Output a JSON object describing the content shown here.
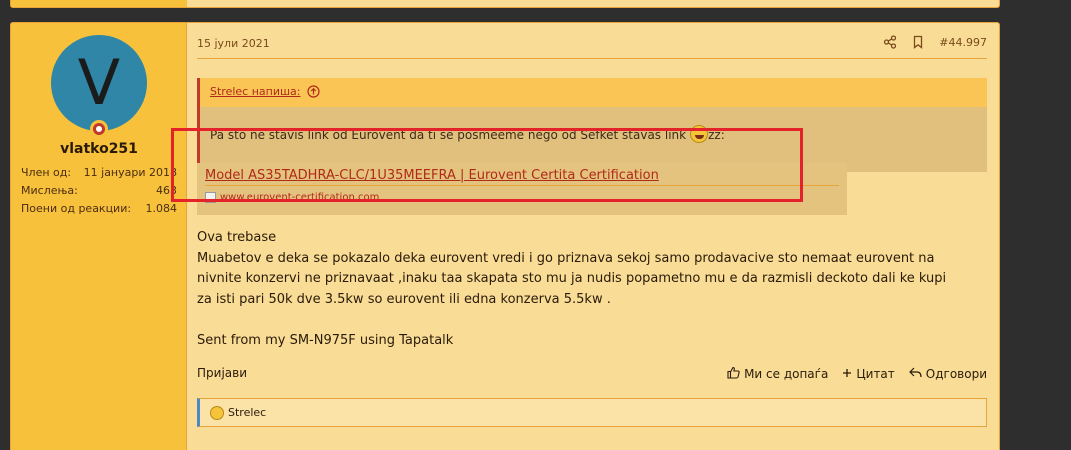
{
  "post": {
    "date": "15 јули 2021",
    "number": "#44.997",
    "author": {
      "initial": "V",
      "username": "vlatko251",
      "stats": [
        {
          "label": "Член од:",
          "value": "11 јануари 2018"
        },
        {
          "label": "Мислења:",
          "value": "463"
        },
        {
          "label": "Поени од реакции:",
          "value": "1.084"
        }
      ]
    },
    "quote": {
      "author_label": "Strelec напиша:",
      "text": "Pa sto ne stavis link od Eurovent da ti se posmeeme nego od Sefket stavas link",
      "suffix": "zz:"
    },
    "unfurl": {
      "title": "Model AS35TADHRA-CLC/1U35MEEFRA | Eurovent Certita Certification",
      "domain": "www.eurovent-certification.com"
    },
    "body_lines": [
      "Ova trebase",
      "Muabetov e deka se pokazalo deka eurovent vredi i go priznava sekoj samo prodavacive sto nemaat eurovent na",
      "nivnite konzervi ne priznavaat ,inaku taa skapata sto mu ja nudis popametno mu e da razmisli deckoto dali ke kupi",
      "za isti pari 50k dve 3.5kw so eurovent ili edna konzerva 5.5kw .",
      "",
      "Sent from my SM-N975F using Tapatalk"
    ],
    "actions": {
      "report": "Пријави",
      "like": "Ми се допаѓа",
      "quote": "Цитат",
      "reply": "Одговори"
    },
    "reactions": {
      "users": "Strelec"
    }
  },
  "colors": {
    "accent_red": "#e3222a",
    "link": "#b02a1a",
    "sidebar": "#f7c13b",
    "post_bg": "#f9dd96"
  }
}
